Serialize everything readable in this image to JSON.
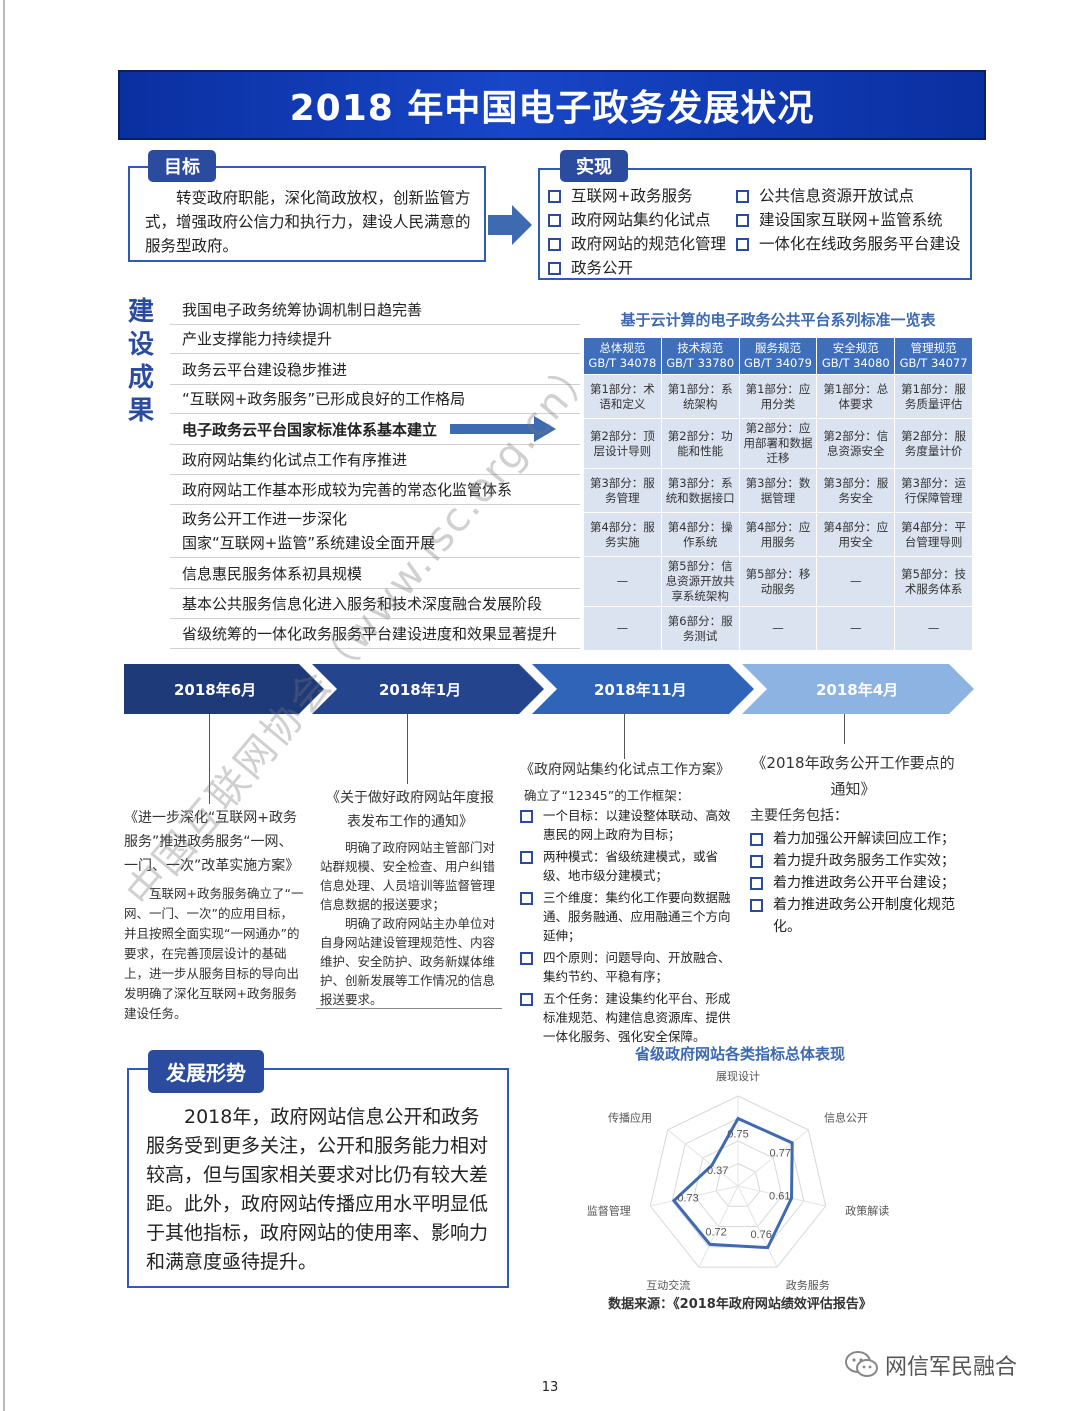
{
  "title": "2018 年中国电子政务发展状况",
  "goal": {
    "tab": "目标",
    "text": "转变政府职能，深化简政放权，创新监管方式，增强政府公信力和执行力，建设人民满意的服务型政府。"
  },
  "realize": {
    "tab": "实现",
    "col1": [
      "互联网+政务服务",
      "政府网站集约化试点",
      "政府网站的规范化管理",
      "政务公开"
    ],
    "col2": [
      "公共信息资源开放试点",
      "建设国家互联网+监管系统",
      "一体化在线政务服务平台建设"
    ]
  },
  "achievements": {
    "heading": "建设成果",
    "items": [
      "我国电子政务统筹协调机制日趋完善",
      "产业支撑能力持续提升",
      "政务云平台建设稳步推进",
      "“互联网+政务服务”已形成良好的工作格局",
      "电子政务云平台国家标准体系基本建立",
      "政府网站集约化试点工作有序推进",
      "政府网站工作基本形成较为完善的常态化监管体系",
      "政务公开工作进一步深化",
      "国家“互联网+监管”系统建设全面开展",
      "信息惠民服务体系初具规模",
      "基本公共服务信息化进入服务和技术深度融合发展阶段",
      "省级统筹的一体化政务服务平台建设进度和效果显著提升"
    ]
  },
  "standards": {
    "title": "基于云计算的电子政务公共平台系列标准一览表",
    "headers": [
      "总体规范GB/T 34078",
      "技术规范GB/T 33780",
      "服务规范GB/T 34079",
      "安全规范GB/T 34080",
      "管理规范GB/T 34077"
    ],
    "rows": [
      [
        "第1部分：术语和定义",
        "第1部分：系统架构",
        "第1部分：应用分类",
        "第1部分：总体要求",
        "第1部分：服务质量评估"
      ],
      [
        "第2部分：顶层设计导则",
        "第2部分：功能和性能",
        "第2部分：应用部署和数据迁移",
        "第2部分：信息资源安全",
        "第2部分：服务度量计价"
      ],
      [
        "第3部分：服务管理",
        "第3部分：系统和数据接口",
        "第3部分：数据管理",
        "第3部分：服务安全",
        "第3部分：运行保障管理"
      ],
      [
        "第4部分：服务实施",
        "第4部分：操作系统",
        "第4部分：应用服务",
        "第4部分：应用安全",
        "第4部分：平台管理导则"
      ],
      [
        "—",
        "第5部分：信息资源开放共享系统架构",
        "第5部分：移动服务",
        "—",
        "第5部分：技术服务体系"
      ],
      [
        "—",
        "第6部分：服务测试",
        "—",
        "—",
        "—"
      ]
    ]
  },
  "timeline": {
    "steps": [
      "2018年6月",
      "2018年1月",
      "2018年11月",
      "2018年4月"
    ],
    "doc1": {
      "title": "《进一步深化“互联网+政务服务”推进政务服务“一网、一门、一次”改革实施方案》",
      "body": "互联网+政务服务确立了“一网、一门、一次”的应用目标，并且按照全面实现“一网通办”的要求，在完善顶层设计的基础上，进一步从服务目标的导向出发明确了深化互联网+政务服务建设任务。"
    },
    "doc2": {
      "title": "《关于做好政府网站年度报表发布工作的通知》",
      "body1": "明确了政府网站主管部门对站群规模、安全检查、用户纠错信息处理、人员培训等监督管理信息数据的报送要求；",
      "body2": "明确了政府网站主办单位对自身网站建设管理规范性、内容维护、安全防护、政务新媒体维护、创新发展等工作情况的信息报送要求。"
    },
    "doc3": {
      "title": "《政府网站集约化试点工作方案》",
      "intro": "确立了“12345”的工作框架：",
      "items": [
        "一个目标：以建设整体联动、高效惠民的网上政府为目标；",
        "两种模式：省级统建模式，或省级、地市级分建模式；",
        "三个维度：集约化工作要向数据融通、服务融通、应用融通三个方向延伸；",
        "四个原则：问题导向、开放融合、集约节约、平稳有序；",
        "五个任务：建设集约化平台、形成标准规范、构建信息资源库、提供一体化服务、强化安全保障。"
      ]
    },
    "doc4": {
      "title": "《2018年政务公开工作要点的通知》",
      "intro": "主要任务包括：",
      "items": [
        "着力加强公开解读回应工作；",
        "着力提升政务服务工作实效；",
        "着力推进政务公开平台建设；",
        "着力推进政务公开制度化规范化。"
      ]
    }
  },
  "trend": {
    "tab": "发展形势",
    "text": "2018年，政府网站信息公开和政务服务受到更多关注，公开和服务能力相对较高，但与国家相关要求对比仍有较大差距。此外，政府网站传播应用水平明显低于其他指标，政府网站的使用率、影响力和满意度亟待提升。"
  },
  "chart_data": {
    "type": "radar",
    "title": "省级政府网站各类指标总体表现",
    "categories": [
      "展现设计",
      "信息公开",
      "政策解读",
      "政务服务",
      "互动交流",
      "监督管理",
      "传播应用"
    ],
    "values": [
      0.75,
      0.77,
      0.61,
      0.76,
      0.72,
      0.73,
      0.37
    ],
    "rmax": 1,
    "source": "数据来源：《2018年政府网站绩效评估报告》",
    "color": "#3d6ab0"
  },
  "watermarks": {
    "diagonal": "中国互联网协会（www.isc.org.cn）"
  },
  "footer": {
    "page_number": "13",
    "wechat_name": "网信军民融合"
  },
  "colors": {
    "primary": "#2b4b9f",
    "banner": "#1846c8",
    "table_header": "#3f6fba",
    "table_cell": "#dbe3f0"
  }
}
